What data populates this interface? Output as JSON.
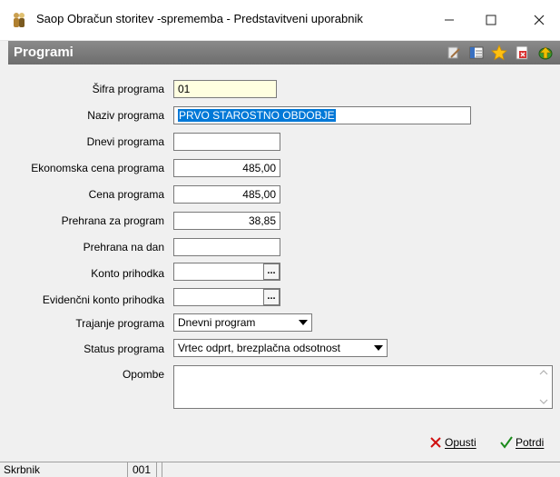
{
  "window": {
    "title": "Saop Obračun storitev -sprememba - Predstavitveni uporabnik",
    "app_icon": "people-icon",
    "controls": [
      "minimize",
      "maximize",
      "close"
    ]
  },
  "header": {
    "title": "Programi",
    "tools": [
      "edit-icon",
      "columns-icon",
      "star-icon",
      "delete-doc-icon",
      "exit-icon"
    ]
  },
  "form": {
    "sifra": {
      "label": "Šifra programa",
      "value": "01"
    },
    "naziv": {
      "label": "Naziv programa",
      "value": "PRVO STAROSTNO OBDOBJE"
    },
    "dnevi": {
      "label": "Dnevi programa",
      "value": ""
    },
    "ekonomska": {
      "label": "Ekonomska cena programa",
      "value": "485,00"
    },
    "cena": {
      "label": "Cena programa",
      "value": "485,00"
    },
    "prehrana": {
      "label": "Prehrana za program",
      "value": "38,85"
    },
    "prehrana_dan": {
      "label": "Prehrana na dan",
      "value": ""
    },
    "konto": {
      "label": "Konto prihodka",
      "value": "",
      "button": "..."
    },
    "evidencni": {
      "label": "Evidenčni konto prihodka",
      "value": "",
      "button": "..."
    },
    "trajanje": {
      "label": "Trajanje programa",
      "value": "Dnevni program"
    },
    "status": {
      "label": "Status programa",
      "value": "Vrtec odprt, brezplačna odsotnost"
    },
    "opombe": {
      "label": "Opombe",
      "value": ""
    }
  },
  "buttons": {
    "cancel": "Opusti",
    "confirm": "Potrdi"
  },
  "statusbar": {
    "cell1": "Skrbnik",
    "cell2": "001"
  },
  "colors": {
    "header_bg": "#7a7a7a",
    "highlight": "#0078d7",
    "key_field_bg": "#ffffe0",
    "cancel_icon": "#d01010",
    "confirm_icon": "#1a8a1a"
  }
}
